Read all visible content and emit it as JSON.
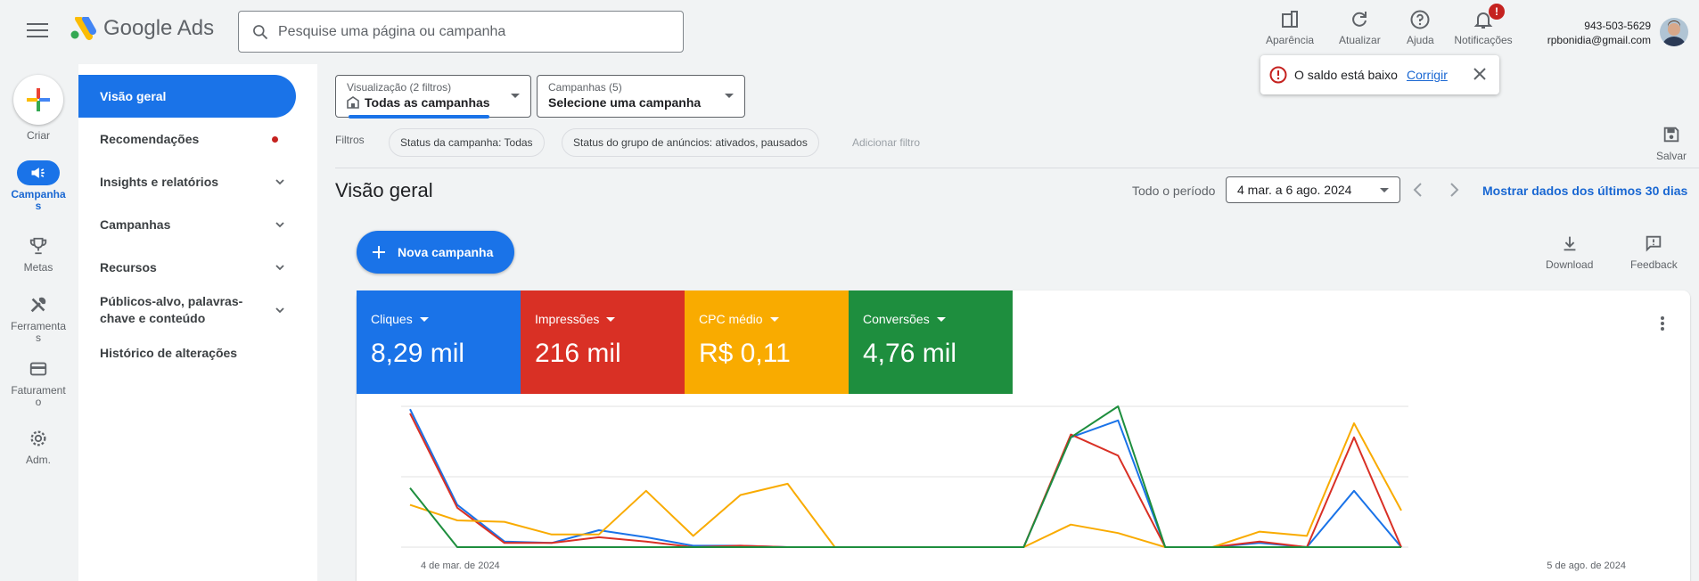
{
  "header": {
    "app_name": "Google Ads",
    "search_placeholder": "Pesquise uma página ou campanha",
    "tools": {
      "appearance": "Aparência",
      "refresh": "Atualizar",
      "help": "Ajuda",
      "notifications": "Notificações",
      "notif_badge": "!"
    },
    "account_id": "943-503-5629",
    "account_email": "rpbonidia@gmail.com"
  },
  "rail": [
    {
      "label": "Criar",
      "icon": "plus-icon"
    },
    {
      "label": "Campanhas",
      "icon": "megaphone-icon",
      "active": true
    },
    {
      "label": "Metas",
      "icon": "trophy-icon"
    },
    {
      "label": "Ferramentas",
      "icon": "tools-icon"
    },
    {
      "label": "Faturamento",
      "icon": "credit-card-icon"
    },
    {
      "label": "Adm.",
      "icon": "gear-icon"
    }
  ],
  "sidenav": {
    "overview": "Visão geral",
    "recommendations": "Recomendações",
    "insights": "Insights e relatórios",
    "campaigns": "Campanhas",
    "resources": "Recursos",
    "audiences": "Públicos-alvo, palavras-chave e conteúdo",
    "history": "Histórico de alterações"
  },
  "view_selector": {
    "label": "Visualização (2 filtros)",
    "value": "Todas as campanhas"
  },
  "campaign_selector": {
    "label": "Campanhas (5)",
    "value": "Selecione uma campanha"
  },
  "filters": {
    "label": "Filtros",
    "chips": [
      "Status da campanha: Todas",
      "Status do grupo de anúncios: ativados, pausados"
    ],
    "add": "Adicionar filtro",
    "save": "Salvar"
  },
  "overview": {
    "title": "Visão geral",
    "period_label": "Todo o período",
    "date_range": "4 mar. a 6 ago. 2024",
    "last30": "Mostrar dados dos últimos 30 dias",
    "new_campaign": "Nova campanha",
    "download": "Download",
    "feedback": "Feedback"
  },
  "toast": {
    "message": "O saldo está baixo",
    "action": "Corrigir"
  },
  "metrics": [
    {
      "label": "Cliques",
      "value": "8,29 mil",
      "color": "#1a73e8"
    },
    {
      "label": "Impressões",
      "value": "216 mil",
      "color": "#d93025"
    },
    {
      "label": "CPC médio",
      "value": "R$ 0,11",
      "color": "#f9ab00"
    },
    {
      "label": "Conversões",
      "value": "4,76 mil",
      "color": "#1e8e3e"
    }
  ],
  "chart_data": {
    "type": "line",
    "x_start_label": "4 de mar. de 2024",
    "x_end_label": "5 de ago. de 2024",
    "ylim": [
      0,
      100
    ],
    "grid": true,
    "legend": "none",
    "series": [
      {
        "color": "#1a73e8",
        "values": [
          98,
          30,
          4,
          3,
          12,
          7,
          1,
          1,
          0,
          0,
          0,
          0,
          0,
          0,
          78,
          90,
          0,
          0,
          3,
          0,
          40,
          0
        ]
      },
      {
        "color": "#d93025",
        "values": [
          95,
          28,
          3,
          3,
          7,
          4,
          0,
          1,
          0,
          0,
          0,
          0,
          0,
          0,
          80,
          65,
          0,
          0,
          4,
          0,
          78,
          0
        ]
      },
      {
        "color": "#f9ab00",
        "values": [
          30,
          19,
          18,
          9,
          9,
          40,
          8,
          37,
          45,
          0,
          0,
          0,
          0,
          0,
          16,
          10,
          0,
          0,
          11,
          8,
          88,
          26
        ]
      },
      {
        "color": "#1e8e3e",
        "values": [
          42,
          0,
          0,
          0,
          0,
          0,
          0,
          0,
          0,
          0,
          0,
          0,
          0,
          0,
          78,
          100,
          0,
          0,
          0,
          0,
          0,
          0
        ]
      }
    ]
  }
}
